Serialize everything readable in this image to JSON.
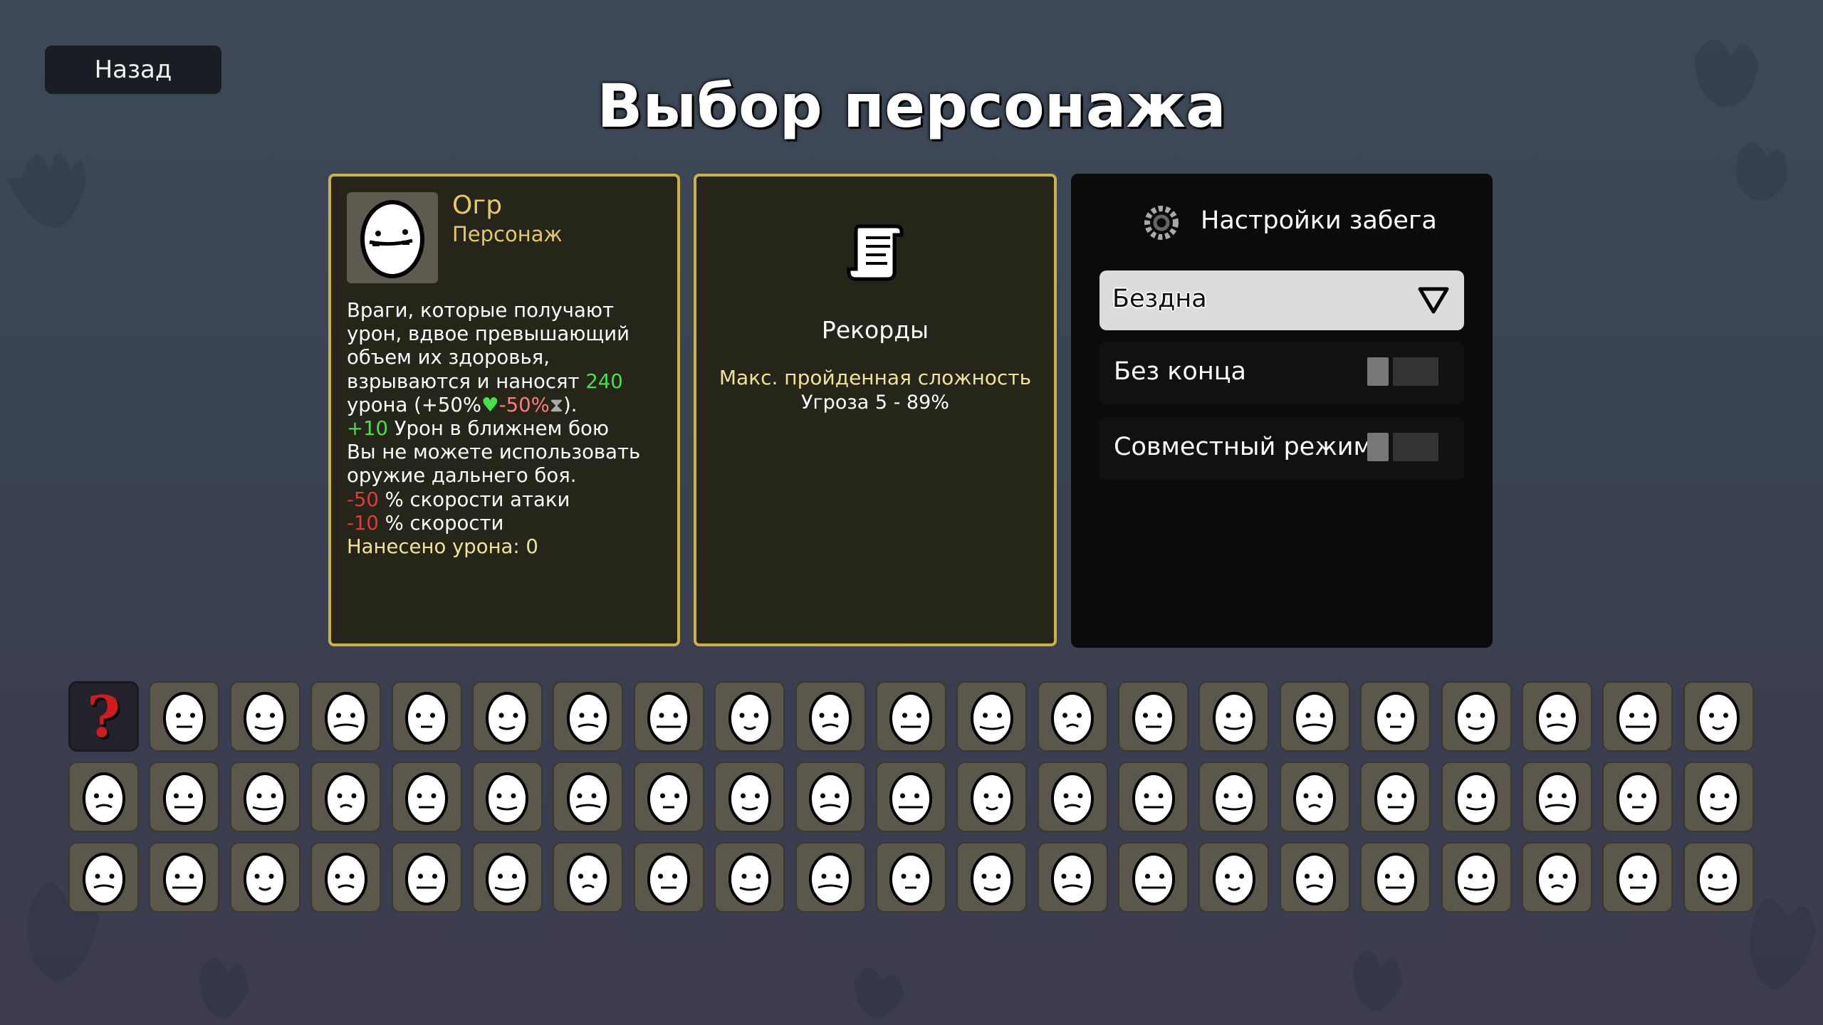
{
  "back_button": {
    "label": "Назад"
  },
  "title": "Выбор персонажа",
  "character": {
    "name": "Огр",
    "type": "Персонаж",
    "portrait_icon": "ogre-egg-icon",
    "description": {
      "l1": "Враги, которые получают",
      "l2": "урон, вдвое превышающий",
      "l3": "объем их здоровья,",
      "l4_text": "взрываются и наносят ",
      "l4_value": "240",
      "l5_pre": "урона (",
      "l5_pos": "+50%",
      "l5_neg": "-50%",
      "l5_post": ").",
      "l6_value": "+10",
      "l6_text": " Урон в ближнем бою",
      "l7": "Вы не можете использовать",
      "l8": "оружие дальнего боя.",
      "l9_value": "-50",
      "l9_text": " % скорости атаки",
      "l10_value": "-10",
      "l10_text": " % скорости",
      "l11": "Нанесено урона: 0"
    }
  },
  "records": {
    "icon": "scroll-icon",
    "title": "Рекорды",
    "max_difficulty_label": "Макс. пройденная сложность",
    "max_difficulty_value": "Угроза 5 - 89%"
  },
  "run_settings": {
    "icon": "gear-icon",
    "title": "Настройки забега",
    "mode_selected": "Бездна",
    "endless": {
      "label": "Без конца",
      "enabled": false
    },
    "coop": {
      "label": "Совместный режим",
      "enabled": false
    }
  },
  "character_grid": {
    "columns": 21,
    "rows": 3,
    "selected_index": 0,
    "cells": [
      "random-character-icon",
      "well-rounded",
      "brawler",
      "crazy",
      "ranger",
      "mage",
      "chunky",
      "old",
      "lucky",
      "mutant",
      "generalist",
      "loud",
      "multitasker",
      "wildling",
      "pacifist",
      "gladiator",
      "saver",
      "sick",
      "farmer",
      "ghost",
      "speedy",
      "entrepreneur",
      "knight",
      "demon",
      "baby",
      "vagabond",
      "technomage",
      "streamer",
      "cyborg",
      "glutton",
      "jack",
      "lich",
      "apprentice",
      "cryptid",
      "fisherman",
      "golem",
      "king",
      "renegade",
      "one-arm",
      "bull",
      "soldier",
      "masochist",
      "ogre",
      "romantic",
      "ninja",
      "explorer",
      "engineer",
      "hunter",
      "artificer",
      "arms-dealer",
      "sailor",
      "creature",
      "hiker",
      "dwarf",
      "curious",
      "gangster",
      "druid",
      "vampire",
      "chef",
      "diver",
      "builder",
      "buccaneer",
      "knight-2"
    ]
  }
}
